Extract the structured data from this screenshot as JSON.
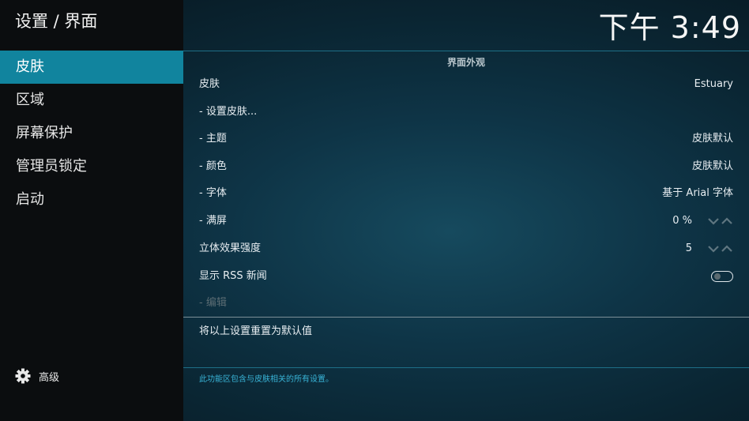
{
  "header": {
    "title": "设置 / 界面",
    "clock": "下午 3:49"
  },
  "sidebar": {
    "items": [
      {
        "label": "皮肤"
      },
      {
        "label": "区域"
      },
      {
        "label": "屏幕保护"
      },
      {
        "label": "管理员锁定"
      },
      {
        "label": "启动"
      }
    ],
    "active_index": 0,
    "advanced_label": "高级"
  },
  "main": {
    "section_title": "界面外观",
    "rows": [
      {
        "label": "皮肤",
        "value": "Estuary"
      },
      {
        "label": "- 设置皮肤...",
        "value": ""
      },
      {
        "label": "- 主题",
        "value": "皮肤默认"
      },
      {
        "label": "- 颜色",
        "value": "皮肤默认"
      },
      {
        "label": "- 字体",
        "value": "基于 Arial 字体"
      },
      {
        "label": "- 满屏",
        "value": "0 %"
      },
      {
        "label": "立体效果强度",
        "value": "5"
      },
      {
        "label": "显示 RSS 新闻",
        "value": "",
        "toggle": false
      },
      {
        "label": "- 编辑",
        "value": "",
        "disabled": true
      }
    ],
    "reset_label": "将以上设置重置为默认值",
    "description": "此功能区包含与皮肤相关的所有设置。"
  },
  "colors": {
    "accent": "#11849e",
    "description": "#38b3d6",
    "sidebar_bg": "#0b0d0f"
  },
  "icons": {
    "advanced": "gear-icon",
    "spinner": "chevron-down-up-icon",
    "rss": "toggle-switch"
  }
}
